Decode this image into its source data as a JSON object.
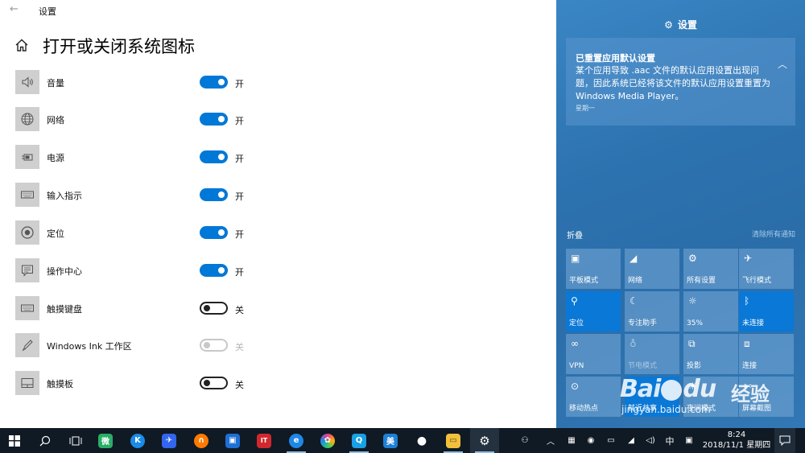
{
  "window": {
    "title": "设置",
    "back_glyph": "←"
  },
  "page": {
    "title": "打开或关闭系统图标"
  },
  "icons": [
    {
      "label": "音量",
      "icon": "volume-icon",
      "state": "on",
      "state_label": "开"
    },
    {
      "label": "网络",
      "icon": "globe-icon",
      "state": "on",
      "state_label": "开"
    },
    {
      "label": "电源",
      "icon": "battery-icon",
      "state": "on",
      "state_label": "开"
    },
    {
      "label": "输入指示",
      "icon": "keyboard-icon",
      "state": "on",
      "state_label": "开"
    },
    {
      "label": "定位",
      "icon": "location-icon",
      "state": "on",
      "state_label": "开"
    },
    {
      "label": "操作中心",
      "icon": "message-icon",
      "state": "on",
      "state_label": "开"
    },
    {
      "label": "触摸键盘",
      "icon": "touch-keyboard-icon",
      "state": "off",
      "state_label": "关"
    },
    {
      "label": "Windows Ink 工作区",
      "icon": "pen-icon",
      "state": "disabled",
      "state_label": "关"
    },
    {
      "label": "触摸板",
      "icon": "touchpad-icon",
      "state": "off",
      "state_label": "关"
    }
  ],
  "action_center": {
    "header": "设置",
    "header_icon": "gear-icon",
    "notification": {
      "title": "已重置应用默认设置",
      "body": "某个应用导致 .aac 文件的默认应用设置出现问题，因此系统已经将该文件的默认应用设置重置为 Windows Media Player。",
      "day": "星期一"
    },
    "collapse_label": "折叠",
    "clear_all_label": "清除所有通知",
    "quick_actions": [
      {
        "label": "平板模式",
        "icon": "tablet-icon",
        "active": false
      },
      {
        "label": "网络",
        "icon": "network-icon",
        "active": false
      },
      {
        "label": "所有设置",
        "icon": "gear-icon",
        "active": false
      },
      {
        "label": "飞行模式",
        "icon": "airplane-icon",
        "active": false
      },
      {
        "label": "定位",
        "icon": "location-icon",
        "active": true
      },
      {
        "label": "专注助手",
        "icon": "moon-icon",
        "active": false
      },
      {
        "label": "35%",
        "icon": "brightness-icon",
        "active": false
      },
      {
        "label": "未连接",
        "icon": "bluetooth-icon",
        "active": true
      },
      {
        "label": "VPN",
        "icon": "vpn-icon",
        "active": false
      },
      {
        "label": "节电模式",
        "icon": "battery-saver-icon",
        "active": false,
        "dim": true
      },
      {
        "label": "投影",
        "icon": "project-icon",
        "active": false
      },
      {
        "label": "连接",
        "icon": "connect-icon",
        "active": false
      },
      {
        "label": "移动热点",
        "icon": "hotspot-icon",
        "active": false
      },
      {
        "label": "就近共享",
        "icon": "nearby-share-icon",
        "active": true
      },
      {
        "label": "夜间模式",
        "icon": "night-light-icon",
        "active": false
      },
      {
        "label": "屏幕截图",
        "icon": "snip-icon",
        "active": false
      }
    ]
  },
  "watermark": {
    "logo": "Bai",
    "logo_end": "du",
    "cn": "经验",
    "url": "jingyan.baidu.com"
  },
  "taskbar": {
    "apps": [
      {
        "name": "wechat",
        "glyph": "微",
        "color": "#2aae67"
      },
      {
        "name": "kugou",
        "glyph": "K",
        "color": "#1a8be8"
      },
      {
        "name": "feishu",
        "glyph": "✈",
        "color": "#3366ee"
      },
      {
        "name": "browser-orange",
        "glyph": "∩",
        "color": "#ff7a00"
      },
      {
        "name": "office",
        "glyph": "▣",
        "color": "#1e6fd6"
      },
      {
        "name": "it-app",
        "glyph": "IT",
        "color": "#d0282e"
      },
      {
        "name": "ie-browser",
        "glyph": "e",
        "color": "#1e88e5"
      },
      {
        "name": "color-app",
        "glyph": "✿",
        "color": "#e83e8c"
      },
      {
        "name": "qq-app",
        "glyph": "Q",
        "color": "#19a0e6"
      },
      {
        "name": "meitu",
        "glyph": "美",
        "color": "#1e7fd8"
      },
      {
        "name": "qq",
        "glyph": "●",
        "color": "#101a24"
      },
      {
        "name": "file-explorer",
        "glyph": "▭",
        "color": "#f3c03d"
      },
      {
        "name": "settings",
        "glyph": "⚙",
        "color": "#101a24"
      }
    ],
    "ime": "中",
    "time": "8:24",
    "date": "2018/11/1 星期四"
  }
}
